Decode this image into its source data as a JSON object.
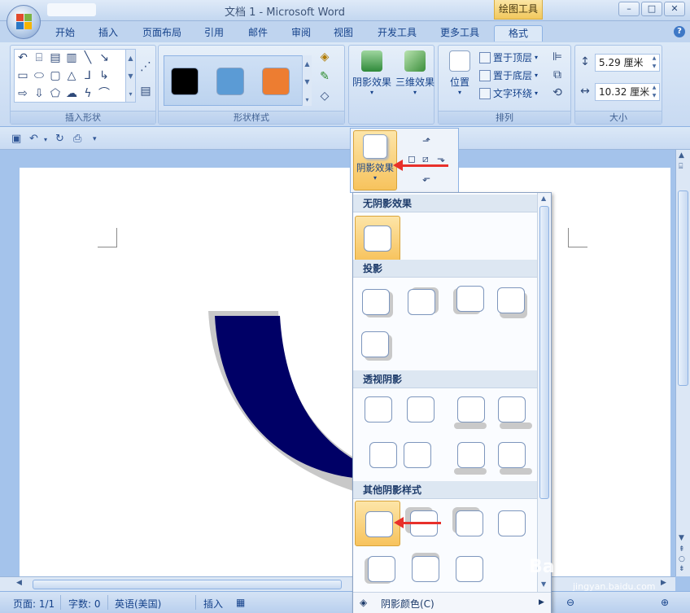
{
  "window": {
    "title": "文档 1 - Microsoft Word",
    "context_tab": "绘图工具",
    "buttons": {
      "minimize": "–",
      "maximize": "□",
      "close": "✕"
    }
  },
  "tabs": [
    "开始",
    "插入",
    "页面布局",
    "引用",
    "邮件",
    "审阅",
    "视图",
    "开发工具",
    "更多工具",
    "格式"
  ],
  "active_tab": "格式",
  "ribbon": {
    "groups": {
      "insert_shapes": "插入形状",
      "shape_styles": "形状样式",
      "arrange": "排列",
      "size": "大小"
    },
    "style_swatches": [
      "#000000",
      "#5b9bd5",
      "#ed7d31"
    ],
    "shadow_effects_label": "阴影效果",
    "three_d_label": "三维效果",
    "position_label": "位置",
    "bring_front": "置于顶层",
    "send_back": "置于底层",
    "text_wrap": "文字环绕",
    "height_value": "5.29 厘米",
    "width_value": "10.32 厘米"
  },
  "flyout": {
    "label": "阴影效果"
  },
  "menu": {
    "sections": {
      "none": "无阴影效果",
      "drop": "投影",
      "perspective": "透视阴影",
      "other": "其他阴影样式"
    },
    "footer": "阴影颜色(C)"
  },
  "status": {
    "page": "页面: 1/1",
    "words": "字数: 0",
    "language": "英语(美国)",
    "mode": "插入"
  },
  "watermark": {
    "brand": "Baidu经验",
    "url": "jingyan.baidu.com"
  },
  "colors": {
    "shape_fill": "#000066",
    "shape_shadow": "#c8c8c8",
    "accent_orange": "#f7c35d"
  }
}
